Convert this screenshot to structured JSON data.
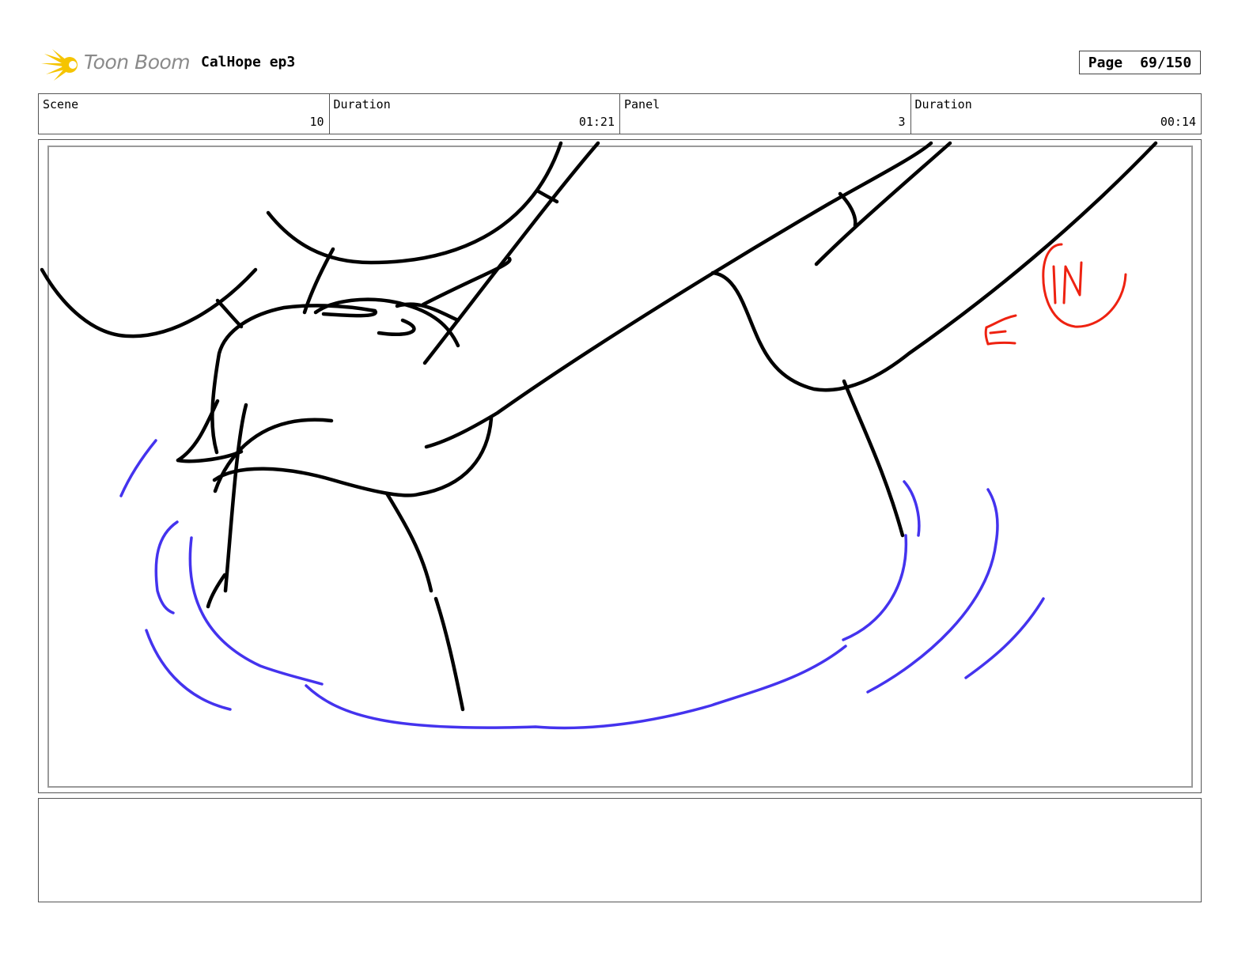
{
  "header": {
    "logo_text": "Toon Boom",
    "project_title": "CalHope ep3",
    "page_label": "Page",
    "page_number": "69/150"
  },
  "info": {
    "scene_label": "Scene",
    "scene_value": "10",
    "scene_duration_label": "Duration",
    "scene_duration_value": "01:21",
    "panel_label": "Panel",
    "panel_value": "3",
    "panel_duration_label": "Duration",
    "panel_duration_value": "00:14"
  },
  "notes": {
    "text": ""
  },
  "colors": {
    "line_art": "#000000",
    "effects": "#4433ee",
    "camera_note": "#ee2211",
    "logo_accent": "#f5c400"
  }
}
